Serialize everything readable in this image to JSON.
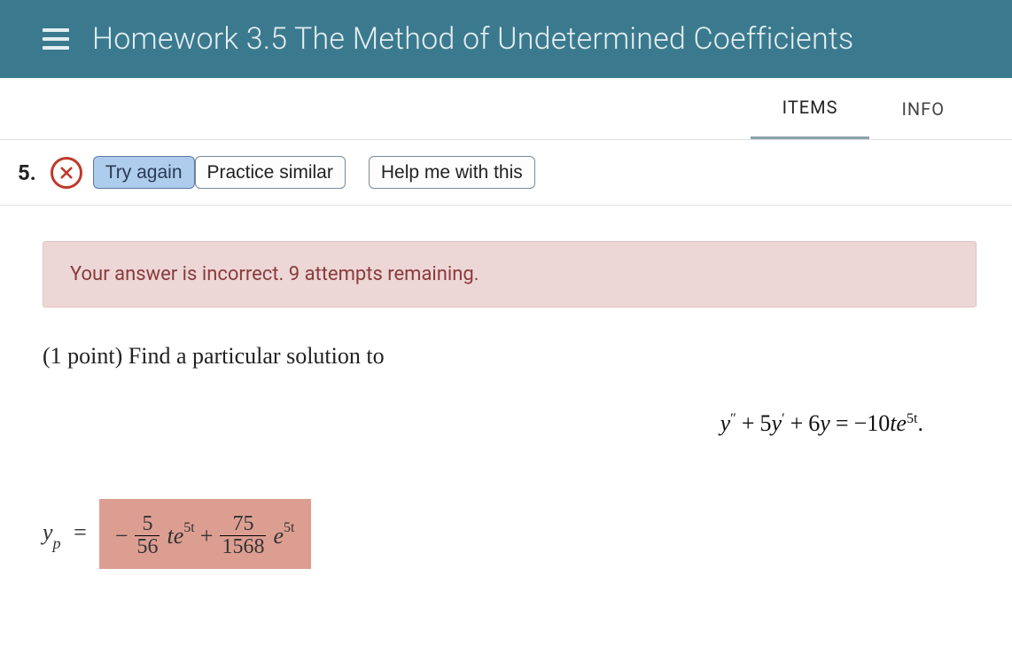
{
  "header": {
    "title": "Homework 3.5 The Method of Undetermined Coefficients"
  },
  "tabs": {
    "items": "ITEMS",
    "info": "INFO",
    "active": "items"
  },
  "toolbar": {
    "question_number": "5.",
    "status": "incorrect",
    "try_again": "Try again",
    "practice_similar": "Practice similar",
    "help": "Help me with this"
  },
  "alert": {
    "message": "Your answer is incorrect. 9 attempts remaining."
  },
  "problem": {
    "prompt": "(1 point) Find a particular solution to",
    "equation_plain": "y'' + 5y' + 6y = -10te^{5t}.",
    "answer_label_plain": "y_p =",
    "answer_value_plain": "-5/56 t e^{5t} + 75/1568 e^{5t}",
    "answer_parts": {
      "neg": "−",
      "frac1_num": "5",
      "frac1_den": "56",
      "term1_base": "te",
      "exp1": "5t",
      "plus": "+",
      "frac2_num": "75",
      "frac2_den": "1568",
      "term2_base": "e",
      "exp2": "5t"
    },
    "equation_parts": {
      "y": "y",
      "dprime": "″",
      "plus1": "+",
      "coef1": "5",
      "prime": "′",
      "plus2": "+",
      "coef2": "6",
      "eq": "=",
      "rhs_neg": "−",
      "rhs_coef": "10",
      "t": "t",
      "e": "e",
      "exp": "5t",
      "period": "."
    },
    "label_parts": {
      "y": "y",
      "sub": "p",
      "eq": "="
    }
  }
}
